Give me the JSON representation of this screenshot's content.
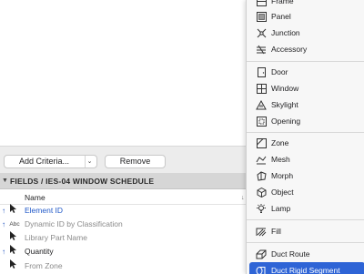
{
  "controls": {
    "add_criteria_label": "Add Criteria...",
    "add_criteria_chevron": "⌄",
    "remove_label": "Remove"
  },
  "fields_section": {
    "title": "FIELDS / IES-04 WINDOW SCHEDULE",
    "toggle_glyph": "▼",
    "column_name": "Name",
    "column_sort_glyph": "↓",
    "rows": [
      {
        "marker": "↑",
        "icon_text": "",
        "label": "Element ID",
        "style": "blue"
      },
      {
        "marker": "↑",
        "icon_text": "Abc",
        "label": "Dynamic ID by Classification",
        "style": "grey"
      },
      {
        "marker": "",
        "icon_text": "",
        "label": "Library Part Name",
        "style": "grey"
      },
      {
        "marker": "↑",
        "icon_text": "",
        "label": "Quantity",
        "style": "dark"
      },
      {
        "marker": "",
        "icon_text": "",
        "label": "From Zone",
        "style": "grey"
      }
    ]
  },
  "menu": {
    "items": [
      {
        "label": "Frame",
        "icon": "frame-icon"
      },
      {
        "label": "Panel",
        "icon": "panel-icon"
      },
      {
        "label": "Junction",
        "icon": "junction-icon"
      },
      {
        "label": "Accessory",
        "icon": "accessory-icon"
      },
      {
        "label": "Door",
        "icon": "door-icon"
      },
      {
        "label": "Window",
        "icon": "window-icon"
      },
      {
        "label": "Skylight",
        "icon": "skylight-icon"
      },
      {
        "label": "Opening",
        "icon": "opening-icon"
      },
      {
        "label": "Zone",
        "icon": "zone-icon"
      },
      {
        "label": "Mesh",
        "icon": "mesh-icon"
      },
      {
        "label": "Morph",
        "icon": "morph-icon"
      },
      {
        "label": "Object",
        "icon": "object-icon"
      },
      {
        "label": "Lamp",
        "icon": "lamp-icon"
      },
      {
        "label": "Fill",
        "icon": "fill-icon"
      },
      {
        "label": "Duct Route",
        "icon": "duct-route-icon"
      },
      {
        "label": "Duct Rigid Segment",
        "icon": "duct-rigid-segment-icon"
      }
    ],
    "selected": "Duct Rigid Segment"
  },
  "colors": {
    "selection": "#2e64d6",
    "link_blue": "#2159c8",
    "header_bg": "#d6d6d6"
  }
}
